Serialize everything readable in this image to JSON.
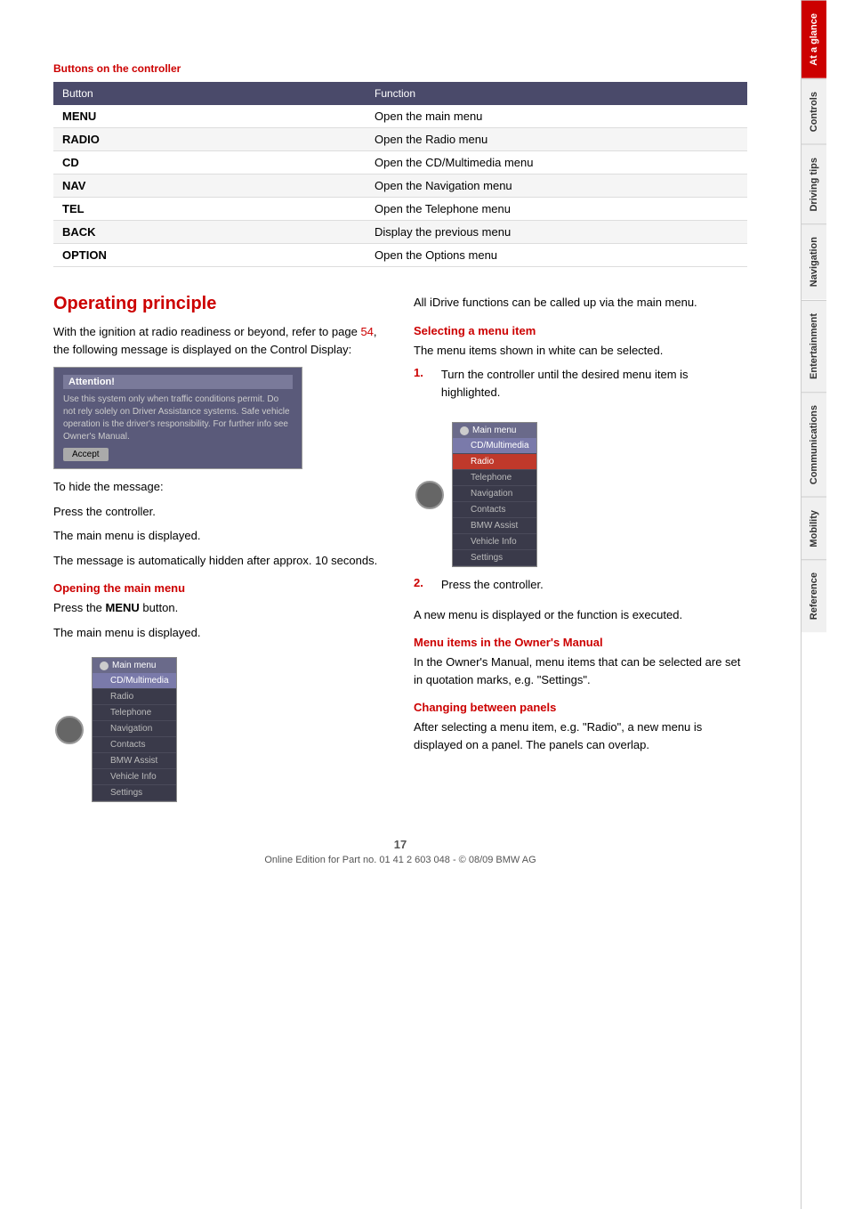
{
  "sidebar": {
    "tabs": [
      {
        "id": "at-a-glance",
        "label": "At a glance",
        "active": true
      },
      {
        "id": "controls",
        "label": "Controls",
        "active": false
      },
      {
        "id": "driving-tips",
        "label": "Driving tips",
        "active": false
      },
      {
        "id": "navigation",
        "label": "Navigation",
        "active": false
      },
      {
        "id": "entertainment",
        "label": "Entertainment",
        "active": false
      },
      {
        "id": "communications",
        "label": "Communications",
        "active": false
      },
      {
        "id": "mobility",
        "label": "Mobility",
        "active": false
      },
      {
        "id": "reference",
        "label": "Reference",
        "active": false
      }
    ]
  },
  "buttons_section": {
    "title": "Buttons on the controller",
    "table": {
      "headers": [
        "Button",
        "Function"
      ],
      "rows": [
        {
          "button": "MENU",
          "function": "Open the main menu"
        },
        {
          "button": "RADIO",
          "function": "Open the Radio menu"
        },
        {
          "button": "CD",
          "function": "Open the CD/Multimedia menu"
        },
        {
          "button": "NAV",
          "function": "Open the Navigation menu"
        },
        {
          "button": "TEL",
          "function": "Open the Telephone menu"
        },
        {
          "button": "BACK",
          "function": "Display the previous menu"
        },
        {
          "button": "OPTION",
          "function": "Open the Options menu"
        }
      ]
    }
  },
  "operating_principle": {
    "title": "Operating principle",
    "intro_text": "With the ignition at radio readiness or beyond, refer to page ",
    "intro_link": "54",
    "intro_text2": ", the following message is displayed on the Control Display:",
    "attention_box": {
      "title": "Attention!",
      "text": "Use this system only when traffic conditions permit. Do not rely solely on Driver Assistance systems. Safe vehicle operation is the driver's responsibility. For further info see Owner's Manual.",
      "accept_button": "Accept"
    },
    "hide_message_text1": "To hide the message:",
    "hide_message_text2": "Press the controller.",
    "hide_message_text3": "The main menu is displayed.",
    "auto_hide_text": "The message is automatically hidden after approx. 10 seconds.",
    "opening_main_menu": {
      "subtitle": "Opening the main menu",
      "text1": "Press the ",
      "bold": "MENU",
      "text2": " button.",
      "text3": "The main menu is displayed."
    },
    "main_menu_items": [
      "CD/Multimedia",
      "Radio",
      "Telephone",
      "Navigation",
      "Contacts",
      "BMW Assist",
      "Vehicle Info",
      "Settings"
    ],
    "right_column": {
      "intro_text": "All iDrive functions can be called up via the main menu.",
      "selecting_menu_item": {
        "subtitle": "Selecting a menu item",
        "text1": "The menu items shown in white can be selected.",
        "step1_num": "1.",
        "step1_text": "Turn the controller until the desired menu item is highlighted.",
        "step2_num": "2.",
        "step2_text": "Press the controller.",
        "step3_text": "A new menu is displayed or the function is executed."
      },
      "menu_items_owners_manual": {
        "subtitle": "Menu items in the Owner's Manual",
        "text": "In the Owner's Manual, menu items that can be selected are set in quotation marks, e.g. \"Settings\"."
      },
      "changing_between_panels": {
        "subtitle": "Changing between panels",
        "text": "After selecting a menu item, e.g. \"Radio\", a new menu is displayed on a panel. The panels can overlap."
      }
    }
  },
  "footer": {
    "page_number": "17",
    "copyright_text": "Online Edition for Part no. 01 41 2 603 048 - © 08/09 BMW AG"
  }
}
